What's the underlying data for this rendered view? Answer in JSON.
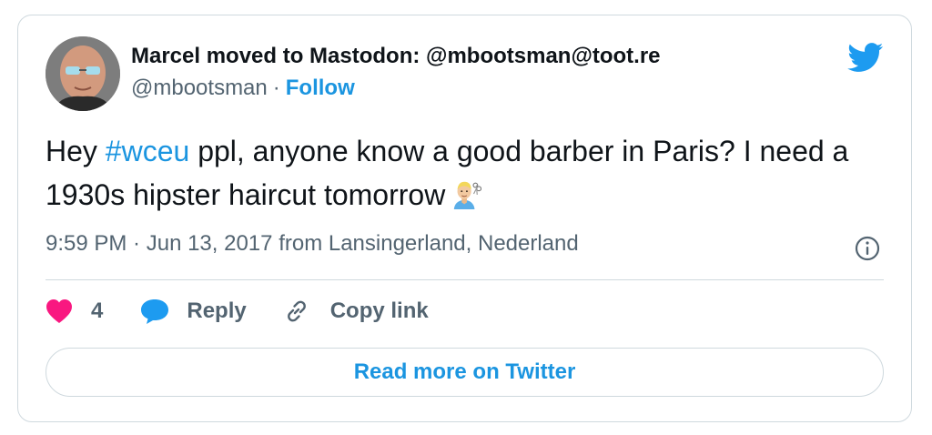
{
  "author": {
    "display_name": "Marcel moved to Mastodon: @mbootsman@toot.re",
    "handle": "@mbootsman",
    "separator": "·",
    "follow_label": "Follow"
  },
  "tweet": {
    "text_before": "Hey ",
    "hashtag": "#wceu",
    "text_after": " ppl, anyone know a good barber in Paris? I need a 1930s hipster haircut tomorrow",
    "emoji": "man-getting-haircut-emoji"
  },
  "meta": {
    "time": "9:59 PM",
    "date": "Jun 13, 2017",
    "location_prefix": "from",
    "location": "Lansingerland, Nederland"
  },
  "actions": {
    "like_count": "4",
    "reply_label": "Reply",
    "copy_link_label": "Copy link"
  },
  "read_more_label": "Read more on Twitter",
  "colors": {
    "link_blue": "#1b95e0",
    "heart_pink": "#f91880",
    "reply_blue": "#1d9bf0",
    "text_dark": "#0f1419",
    "text_grey": "#536471",
    "border": "#cfd9de"
  }
}
